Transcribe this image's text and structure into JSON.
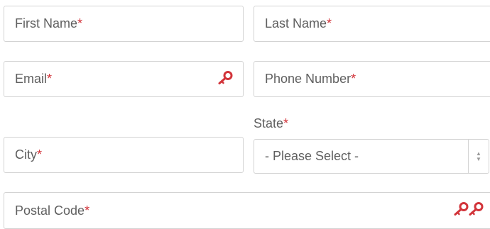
{
  "form": {
    "first_name": {
      "label": "First Name",
      "required_mark": "*"
    },
    "last_name": {
      "label": "Last Name",
      "required_mark": "*"
    },
    "email": {
      "label": "Email",
      "required_mark": "*",
      "icon": "key-icon"
    },
    "phone": {
      "label": "Phone Number",
      "required_mark": "*"
    },
    "state": {
      "label": "State",
      "required_mark": "*",
      "selected": "- Please Select -"
    },
    "city": {
      "label": "City",
      "required_mark": "*"
    },
    "postal_code": {
      "label": "Postal Code",
      "required_mark": "*",
      "icon": "double-key-icon"
    }
  },
  "colors": {
    "required": "#d2343a",
    "border": "#d3d3d3",
    "text": "#5f5f5f"
  }
}
